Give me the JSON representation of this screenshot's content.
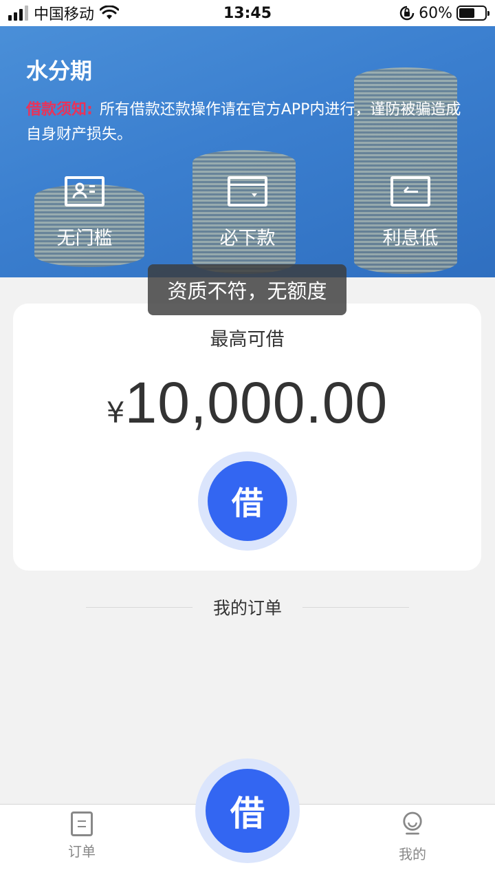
{
  "status_bar": {
    "carrier": "中国移动",
    "time": "13:45",
    "battery": "60%",
    "battery_level": 0.6,
    "icons": [
      "signal-icon",
      "wifi-icon",
      "orientation-lock-icon",
      "battery-icon"
    ]
  },
  "banner": {
    "title": "水分期",
    "notice_label": "借款须知:",
    "notice_text": "所有借款还款操作请在官方APP内进行，谨防被骗造成自身财产损失。",
    "features": [
      {
        "label": "无门槛",
        "icon": "id-card-icon"
      },
      {
        "label": "必下款",
        "icon": "wallet-icon"
      },
      {
        "label": "利息低",
        "icon": "rate-card-icon"
      }
    ]
  },
  "toast": {
    "text": "资质不符，无额度"
  },
  "card": {
    "title": "最高可借",
    "currency_symbol": "¥",
    "amount": "10,000.00",
    "borrow_button": "借"
  },
  "orders": {
    "title": "我的订单"
  },
  "tab_bar": {
    "orders_label": "订单",
    "center_button": "借",
    "me_label": "我的"
  },
  "colors": {
    "accent": "#3366f2",
    "notice_label": "#e8335a",
    "banner": "#3b7fcf"
  }
}
